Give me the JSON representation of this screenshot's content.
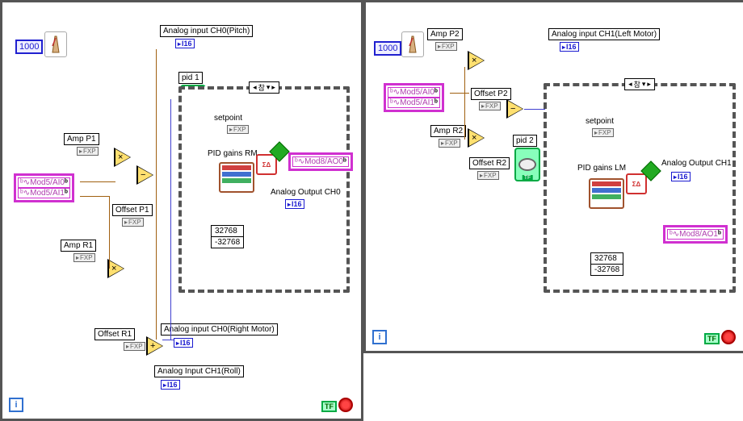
{
  "left": {
    "timer": "1000",
    "analogInPitch": "Analog input CH0(Pitch)",
    "ampP1": "Amp P1",
    "ampR1": "Amp R1",
    "offsetP1": "Offset P1",
    "offsetR1": "Offset R1",
    "pid1": "pid 1",
    "ioMod5_0": "Mod5/AI0",
    "ioMod5_1": "Mod5/AI1",
    "case": {
      "selector": "참",
      "setpoint": "setpoint",
      "pidGainsRM": "PID gains RM",
      "mod8AO0": "Mod8/AO0",
      "analogOutCH0": "Analog Output CH0",
      "rangeHi": "32768",
      "rangeLo": "-32768"
    },
    "analogInRight": "Analog input CH0(Right Motor)",
    "analogInRoll": "Analog Input CH1(Roll)",
    "i16": "I16",
    "fxp": "FXP",
    "tf": "TF"
  },
  "right": {
    "timer": "1000",
    "analogInLeft": "Analog input CH1(Left Motor)",
    "ampP2": "Amp P2",
    "ampR2": "Amp R2",
    "offsetP2": "Offset P2",
    "offsetR2": "Offset R2",
    "pid2": "pid 2",
    "ioMod5_0": "Mod5/AI0",
    "ioMod5_1": "Mod5/AI1",
    "case": {
      "selector": "참",
      "setpoint": "setpoint",
      "pidGainsLM": "PID gains LM",
      "mod8AO1": "Mod8/AO1",
      "analogOutCH1": "Analog Output CH1",
      "rangeHi": "32768",
      "rangeLo": "-32768"
    },
    "i16": "I16",
    "fxp": "FXP",
    "tf": "TF"
  },
  "ioPrefix": "ᵇ∿"
}
